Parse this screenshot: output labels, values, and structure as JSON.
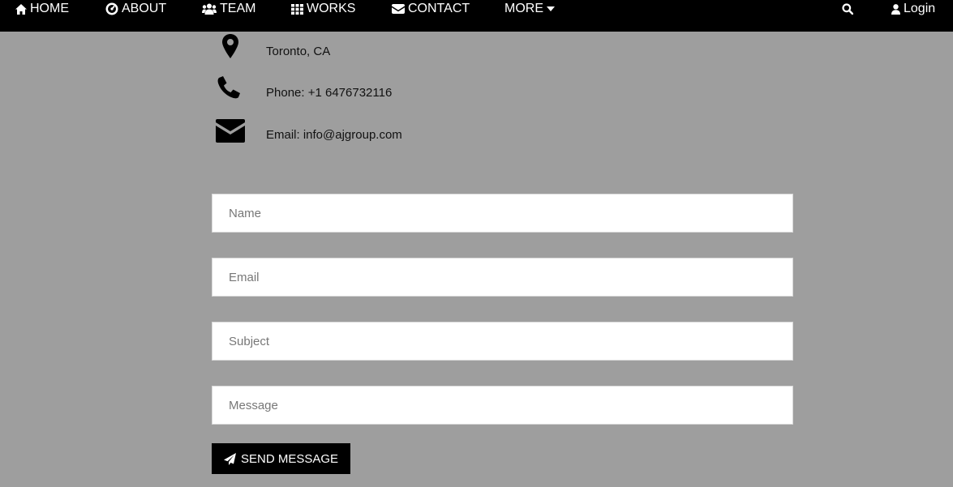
{
  "nav": {
    "home": "HOME",
    "about": "ABOUT",
    "team": "TEAM",
    "works": "WORKS",
    "contact": "CONTACT",
    "more": "MORE",
    "login": "Login",
    "icons": [
      "home-icon",
      "dashboard-icon",
      "users-icon",
      "grid-icon",
      "envelope-icon",
      "caret-down-icon",
      "search-icon",
      "user-icon"
    ]
  },
  "contact_info": {
    "location": "Toronto, CA",
    "phone": "Phone: +1 6476732116",
    "email": "Email: info@ajgroup.com",
    "icons": [
      "map-marker-icon",
      "phone-icon",
      "envelope-icon"
    ]
  },
  "form": {
    "name_placeholder": "Name",
    "email_placeholder": "Email",
    "subject_placeholder": "Subject",
    "message_placeholder": "Message",
    "name_value": "",
    "email_value": "",
    "subject_value": "",
    "message_value": "",
    "submit_label": "SEND MESSAGE",
    "submit_icon": "paper-plane-icon"
  },
  "colors": {
    "background": "#9e9e9e",
    "navbar": "#000000",
    "button": "#000000",
    "field": "#ffffff"
  }
}
